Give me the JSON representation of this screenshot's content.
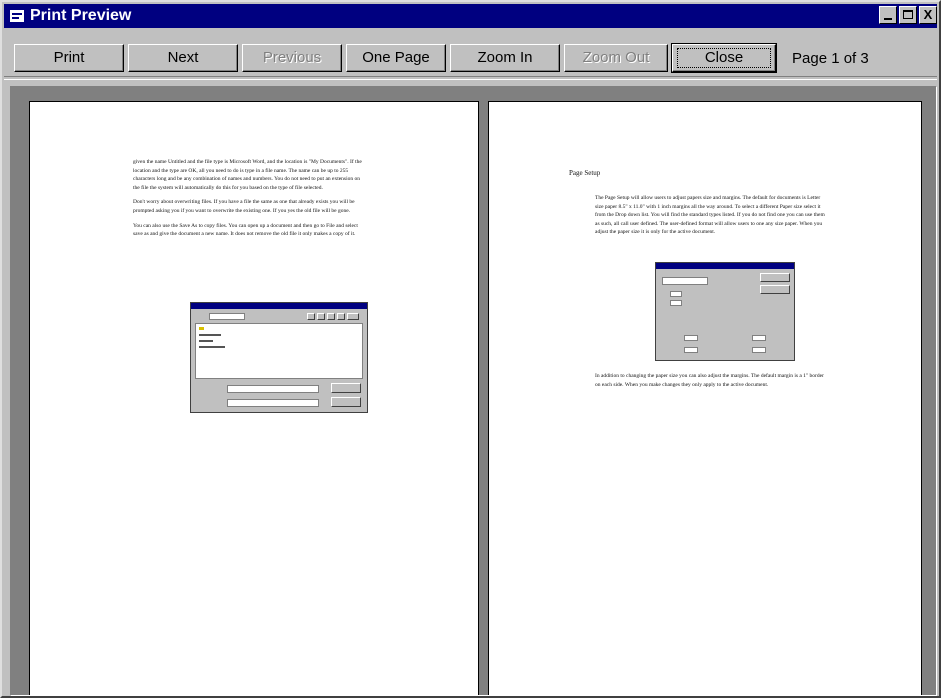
{
  "window": {
    "title": "Print Preview",
    "controls": {
      "minimize": "",
      "maximize": "",
      "close": "X"
    }
  },
  "toolbar": {
    "buttons": [
      {
        "label": "Print",
        "enabled": true
      },
      {
        "label": "Next",
        "enabled": true
      },
      {
        "label": "Previous",
        "enabled": false
      },
      {
        "label": "One Page",
        "enabled": true
      },
      {
        "label": "Zoom In",
        "enabled": true
      },
      {
        "label": "Zoom Out",
        "enabled": false
      },
      {
        "label": "Close",
        "enabled": true
      }
    ],
    "page_indicator": "Page 1 of 3"
  },
  "pages": {
    "left": {
      "paragraphs": [
        "given the name Untitled and the file type is Microsoft Word, and the location is \"My Documents\". If the location and the type are OK, all you need to do is type in a file name. The name can be up to 255 characters long and be any combination of names and numbers. You do not need to put an extension on the file the system will automatically do this for you based on the type of file selected.",
        "Don't worry about overwriting files. If you have a file the same as one that already exists you will be prompted asking you if you want to overwrite the existing one. If you yes the old file will be gone.",
        "You can also use the Save As to copy files. You can open up a document and then go to File and select save as and give the document a new name. It does not remove the old file it only makes a copy of it."
      ]
    },
    "right": {
      "heading": "Page Setup",
      "paragraphs": [
        "The Page Setup will allow users to adjust papers size and margins. The default for documents is Letter size paper 8.5\" x 11.0\" with 1 inch margins all the way around. To select a different Paper size select it from the Drop down list. You will find the standard types listed. If you do not find one you can use them as such, all call user defined. The user-defined format will allow users to one any size paper. When you adjust the paper size it is only for the active document.",
        "In addition to changing the paper size you can also adjust the margins. The default margin is a 1\" border on each side. When you make changes they only apply to the active document."
      ]
    }
  }
}
